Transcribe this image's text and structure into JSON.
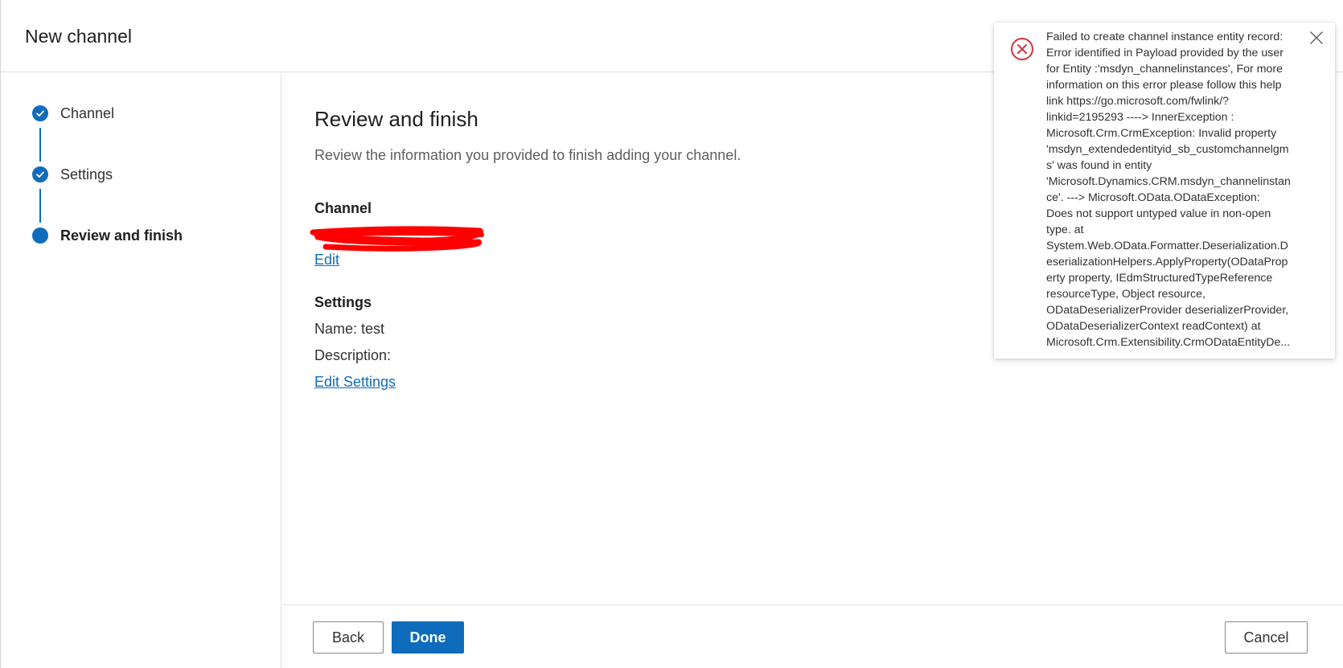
{
  "header": {
    "title": "New channel"
  },
  "steps": [
    {
      "label": "Channel",
      "state": "completed"
    },
    {
      "label": "Settings",
      "state": "completed"
    },
    {
      "label": "Review and finish",
      "state": "current"
    }
  ],
  "main": {
    "title": "Review and finish",
    "subtitle": "Review the information you provided to finish adding your channel.",
    "channel_heading": "Channel",
    "channel_edit_link": "Edit",
    "settings_heading": "Settings",
    "settings_name": "Name: test",
    "settings_description": "Description:",
    "settings_edit_link": "Edit Settings"
  },
  "footer": {
    "back_label": "Back",
    "done_label": "Done",
    "cancel_label": "Cancel"
  },
  "toast": {
    "type": "error",
    "message_lines": [
      "Failed to create channel instance entity record:",
      "Error identified in Payload provided by the user",
      "for Entity :'msdyn_channelinstances', For more",
      "information on this error please follow this help",
      "link https://go.microsoft.com/fwlink/?",
      "linkid=2195293 ----> InnerException :",
      "Microsoft.Crm.CrmException: Invalid property",
      "'msdyn_extendedentityid_sb_customchannelgm",
      "s' was found in entity",
      "'Microsoft.Dynamics.CRM.msdyn_channelinstan",
      "ce'. ---> Microsoft.OData.ODataException:",
      "Does not support untyped value in non-open",
      "type. at",
      "System.Web.OData.Formatter.Deserialization.D",
      "eserializationHelpers.ApplyProperty(ODataProp",
      "erty property, IEdmStructuredTypeReference",
      "resourceType, Object resource,",
      "ODataDeserializerProvider deserializerProvider,",
      "ODataDeserializerContext readContext) at",
      "Microsoft.Crm.Extensibility.CrmODataEntityDe..."
    ],
    "icon": "error-circle-icon",
    "close_icon": "close-icon"
  },
  "colors": {
    "accent": "#0f6cbd",
    "error": "#d13438",
    "redaction": "#ff0000",
    "text": "#323130"
  }
}
